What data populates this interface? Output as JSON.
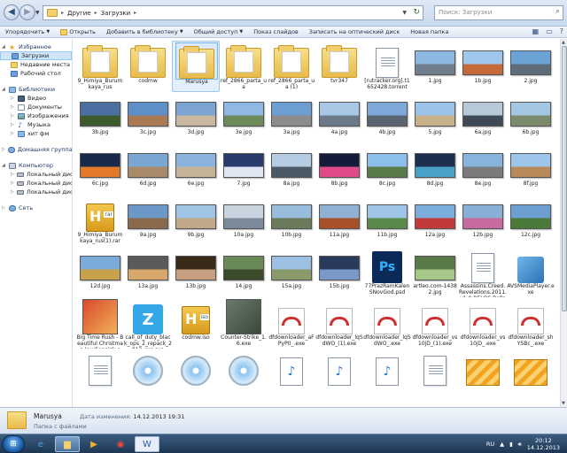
{
  "address": {
    "crumbs": [
      "Другие",
      "Загрузки"
    ],
    "search_placeholder": "Поиск: Загрузки"
  },
  "toolbar": {
    "items": [
      "Упорядочить",
      "Открыть",
      "Добавить в библиотеку",
      "Общий доступ",
      "Показ слайдов",
      "Записать на оптический диск",
      "Новая папка"
    ]
  },
  "nav": {
    "favorites": {
      "label": "Избранное",
      "items": [
        "Загрузки",
        "Недавние места",
        "Рабочий стол"
      ]
    },
    "libraries": {
      "label": "Библиотеки",
      "items": [
        "Видео",
        "Документы",
        "Изображения",
        "Музыка",
        "хит фм"
      ]
    },
    "homegroup": "Домашняя группа",
    "computer": {
      "label": "Компьютер",
      "items": [
        "Локальный диск (C",
        "Локальный диск (D",
        "Локальный диск (F"
      ]
    },
    "network": "Сеть"
  },
  "files": [
    {
      "name": "9_Himiya_Burumkaya_rus",
      "kind": "folder"
    },
    {
      "name": "codmw",
      "kind": "folder"
    },
    {
      "name": "Marusya",
      "kind": "folder",
      "selected": true
    },
    {
      "name": "ref_2866_parta_ua",
      "kind": "folder"
    },
    {
      "name": "ref_2866_parta_ua (1)",
      "kind": "folder"
    },
    {
      "name": "tvr347",
      "kind": "folder"
    },
    {
      "name": "[rutracker.org].t1652428.torrent",
      "kind": "file"
    },
    {
      "name": "1.jpg",
      "kind": "photo",
      "colors": [
        "#8cb7de",
        "#6f7d8c"
      ]
    },
    {
      "name": "1b.jpg",
      "kind": "photo",
      "colors": [
        "#9fc8ec",
        "#c76a3a"
      ]
    },
    {
      "name": "2.jpg",
      "kind": "photo",
      "colors": [
        "#6ba3d6",
        "#5e6b78"
      ]
    },
    {
      "name": "3b.jpg",
      "kind": "photo",
      "colors": [
        "#4a6fa0",
        "#3d5a2c"
      ]
    },
    {
      "name": "3c.jpg",
      "kind": "photo",
      "colors": [
        "#5e8fc8",
        "#a97a54"
      ]
    },
    {
      "name": "3d.jpg",
      "kind": "photo",
      "colors": [
        "#7ba4d1",
        "#c9b8a0"
      ]
    },
    {
      "name": "3e.jpg",
      "kind": "photo",
      "colors": [
        "#8fb8e2",
        "#6f8a5a"
      ]
    },
    {
      "name": "3a.jpg",
      "kind": "photo",
      "colors": [
        "#6d9ed2",
        "#8c8c8c"
      ]
    },
    {
      "name": "4a.jpg",
      "kind": "photo",
      "colors": [
        "#a8c8e6",
        "#6a7a88"
      ]
    },
    {
      "name": "4b.jpg",
      "kind": "photo",
      "colors": [
        "#7ca9d8",
        "#5a6470"
      ]
    },
    {
      "name": "5.jpg",
      "kind": "photo",
      "colors": [
        "#9cc4ea",
        "#c8b088"
      ]
    },
    {
      "name": "6a.jpg",
      "kind": "photo",
      "colors": [
        "#b7c9d8",
        "#3d4a55"
      ]
    },
    {
      "name": "6b.jpg",
      "kind": "photo",
      "colors": [
        "#a3c6e2",
        "#7a8a6a"
      ]
    },
    {
      "name": "6c.jpg",
      "kind": "photo",
      "colors": [
        "#1a2a4a",
        "#e27a2a"
      ]
    },
    {
      "name": "6d.jpg",
      "kind": "photo",
      "colors": [
        "#7aa6d4",
        "#a88a68"
      ]
    },
    {
      "name": "6e.jpg",
      "kind": "photo",
      "colors": [
        "#8ab4de",
        "#c4b498"
      ]
    },
    {
      "name": "7.jpg",
      "kind": "photo",
      "colors": [
        "#2a3a6a",
        "#dfe6f2"
      ]
    },
    {
      "name": "8a.jpg",
      "kind": "photo",
      "colors": [
        "#b5cce2",
        "#4c5a68"
      ]
    },
    {
      "name": "8b.jpg",
      "kind": "photo",
      "colors": [
        "#141c3a",
        "#e04a8a"
      ]
    },
    {
      "name": "8c.jpg",
      "kind": "photo",
      "colors": [
        "#8cc0ea",
        "#5a7a4a"
      ]
    },
    {
      "name": "8d.jpg",
      "kind": "photo",
      "colors": [
        "#1e2e4e",
        "#4aa0c8"
      ]
    },
    {
      "name": "8e.jpg",
      "kind": "photo",
      "colors": [
        "#88b4dc",
        "#7a7a7a"
      ]
    },
    {
      "name": "8f.jpg",
      "kind": "photo",
      "colors": [
        "#9ec6ea",
        "#b88a5a"
      ]
    },
    {
      "name": "9_Himiya_Burumkaya_rus(1).rar",
      "kind": "rar"
    },
    {
      "name": "9a.jpg",
      "kind": "photo",
      "colors": [
        "#6c98c8",
        "#8a6a4a"
      ]
    },
    {
      "name": "9b.jpg",
      "kind": "photo",
      "colors": [
        "#a0c4e4",
        "#c0a888"
      ]
    },
    {
      "name": "10a.jpg",
      "kind": "photo",
      "colors": [
        "#c8d4de",
        "#7a8a9a"
      ]
    },
    {
      "name": "10b.jpg",
      "kind": "photo",
      "colors": [
        "#98bcdc",
        "#6a7a5a"
      ]
    },
    {
      "name": "11a.jpg",
      "kind": "photo",
      "colors": [
        "#8fb2d4",
        "#a8502a"
      ]
    },
    {
      "name": "11b.jpg",
      "kind": "photo",
      "colors": [
        "#9ec4e8",
        "#5a8a4a"
      ]
    },
    {
      "name": "12a.jpg",
      "kind": "photo",
      "colors": [
        "#7aacdc",
        "#c43a3a"
      ]
    },
    {
      "name": "12b.jpg",
      "kind": "photo",
      "colors": [
        "#88b0d6",
        "#c86aa0"
      ]
    },
    {
      "name": "12c.jpg",
      "kind": "photo",
      "colors": [
        "#6c9ed0",
        "#4a7a3a"
      ]
    },
    {
      "name": "12d.jpg",
      "kind": "photo",
      "colors": [
        "#7aaad8",
        "#c8a24a"
      ]
    },
    {
      "name": "13a.jpg",
      "kind": "photo",
      "colors": [
        "#5a5a5a",
        "#d8a86a"
      ]
    },
    {
      "name": "13b.jpg",
      "kind": "photo",
      "colors": [
        "#3a2a1a",
        "#c8a080"
      ]
    },
    {
      "name": "14.jpg",
      "kind": "photo",
      "colors": [
        "#6a8a5a",
        "#3a4a2a"
      ]
    },
    {
      "name": "15a.jpg",
      "kind": "photo",
      "colors": [
        "#9cc0e2",
        "#8a9a6a"
      ]
    },
    {
      "name": "15b.jpg",
      "kind": "photo",
      "colors": [
        "#2a3a5a",
        "#7a98c8"
      ]
    },
    {
      "name": "77PrazRamKalenSNovGod.psd",
      "kind": "psd"
    },
    {
      "name": "artleo.com-14382.jpg",
      "kind": "photo",
      "colors": [
        "#5a7a4a",
        "#a8c888"
      ]
    },
    {
      "name": "Assassins.Creed.Revelations.2011.v1.0.RELOC.RePack.torrent",
      "kind": "file"
    },
    {
      "name": "AVSMediaPlayer.exe",
      "kind": "avs"
    },
    {
      "name": "Big Time Rush - Beautiful Christmas (audiopoisk.co...",
      "kind": "game",
      "colors": [
        "#d84a2a",
        "#f2b05a"
      ]
    },
    {
      "name": "call_of_duty_black_ops_2_repack_2012_rus.exe",
      "kind": "z"
    },
    {
      "name": "codmw.iso",
      "kind": "iso"
    },
    {
      "name": "Counter-Strike_1.6.exe",
      "kind": "game",
      "colors": [
        "#6a7a6a",
        "#3a4a3a"
      ]
    },
    {
      "name": "dfdownloader_aFPyP0_.exe",
      "kind": "cloud"
    },
    {
      "name": "dfdownloader_lqSdWO_(1).exe",
      "kind": "cloud"
    },
    {
      "name": "dfdownloader_lqSdWO_.exe",
      "kind": "cloud"
    },
    {
      "name": "dfdownloader_vs10jD_(1).exe",
      "kind": "cloud"
    },
    {
      "name": "dfdownloader_vs10jD_.exe",
      "kind": "cloud"
    },
    {
      "name": "dfdownloader_shYSBc_.exe",
      "kind": "cloud"
    },
    {
      "name": "",
      "kind": "file"
    },
    {
      "name": "",
      "kind": "disc"
    },
    {
      "name": "",
      "kind": "disc"
    },
    {
      "name": "",
      "kind": "disc"
    },
    {
      "name": "",
      "kind": "note"
    },
    {
      "name": "",
      "kind": "note"
    },
    {
      "name": "",
      "kind": "note"
    },
    {
      "name": "",
      "kind": "file"
    },
    {
      "name": "",
      "kind": "film"
    },
    {
      "name": "",
      "kind": "film"
    }
  ],
  "details": {
    "name": "Marusya",
    "type": "Папка с файлами",
    "date_label": "Дата изменения:",
    "date_value": "14.12.2013 19:31"
  },
  "taskbar": {
    "lang": "RU",
    "time": "20:12",
    "date": "14.12.2013"
  }
}
